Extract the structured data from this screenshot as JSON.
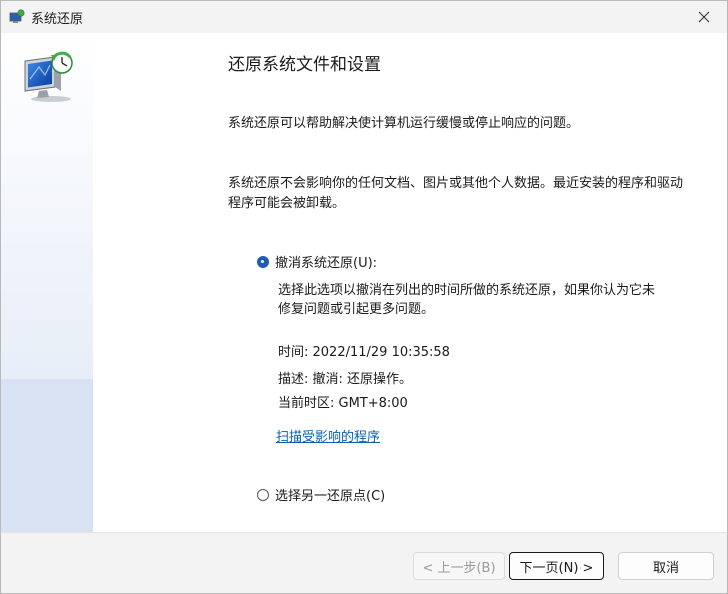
{
  "window": {
    "title": "系统还原",
    "icon": "system-restore-icon"
  },
  "main": {
    "heading": "还原系统文件和设置",
    "para1": "系统还原可以帮助解决使计算机运行缓慢或停止响应的问题。",
    "para2": "系统还原不会影响你的任何文档、图片或其他个人数据。最近安装的程序和驱动程序可能会被卸载。",
    "options": {
      "undo": {
        "label": "撤消系统还原(U):",
        "checked": true,
        "description": "选择此选项以撤消在列出的时间所做的系统还原，如果你认为它未修复问题或引起更多问题。",
        "time": "时间: 2022/11/29 10:35:58",
        "desc_line": "描述: 撤消: 还原操作。",
        "timezone": "当前时区: GMT+8:00",
        "scan_link": "扫描受影响的程序"
      },
      "other": {
        "label": "选择另一还原点(C)",
        "checked": false
      }
    }
  },
  "footer": {
    "back": "< 上一步(B)",
    "next": "下一页(N) >",
    "cancel": "取消"
  },
  "colors": {
    "accent": "#1a5fb4",
    "link": "#0a5fb0"
  }
}
